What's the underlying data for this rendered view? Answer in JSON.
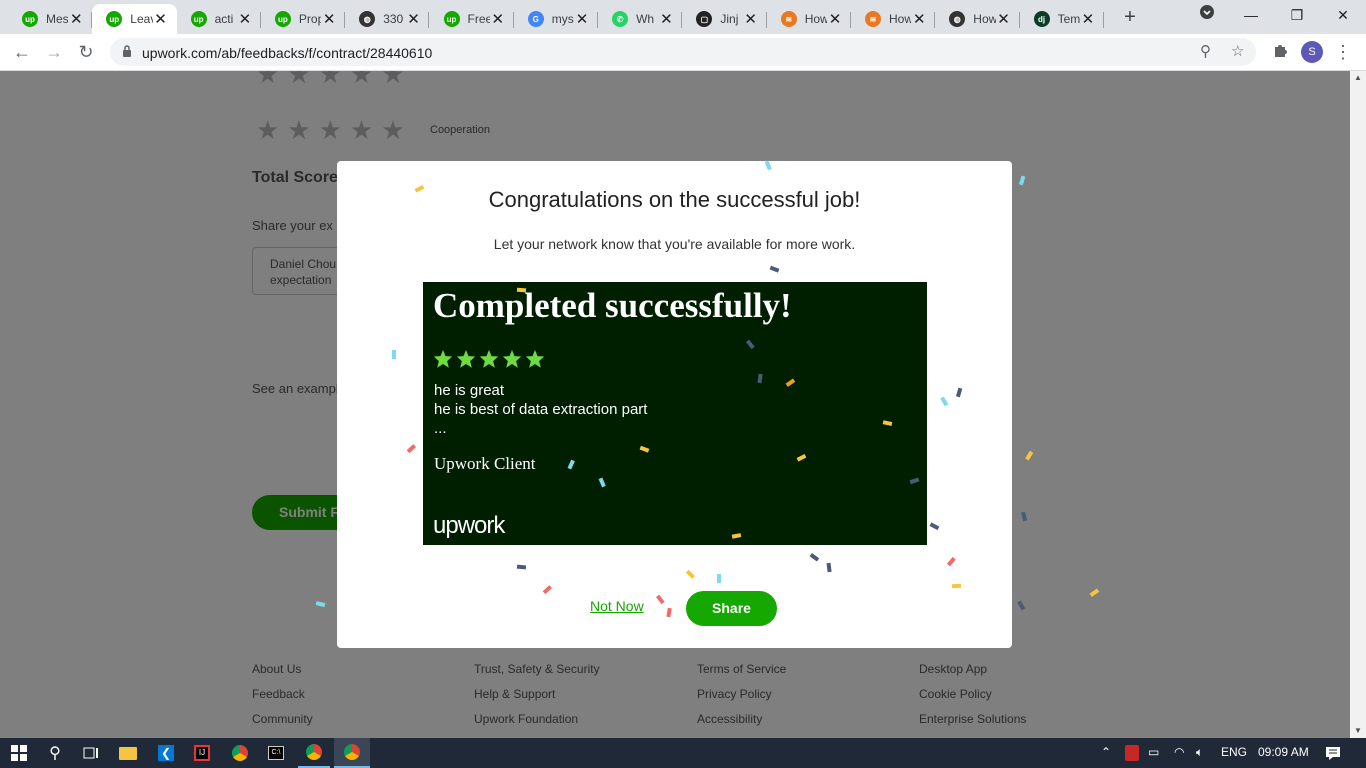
{
  "browser": {
    "tabs": [
      {
        "title": "Mes",
        "favicon": "upwork-icon",
        "color": "#14a800",
        "glyph": "up"
      },
      {
        "title": "Leav",
        "favicon": "upwork-icon",
        "color": "#14a800",
        "glyph": "up",
        "active": true
      },
      {
        "title": "acti",
        "favicon": "upwork-icon",
        "color": "#14a800",
        "glyph": "up"
      },
      {
        "title": "Prop",
        "favicon": "upwork-icon",
        "color": "#14a800",
        "glyph": "up"
      },
      {
        "title": "330",
        "favicon": "globe-icon",
        "color": "#333333",
        "glyph": "◍"
      },
      {
        "title": "Free",
        "favicon": "upwork-icon",
        "color": "#14a800",
        "glyph": "up"
      },
      {
        "title": "mys",
        "favicon": "google-icon",
        "color": "#4285f4",
        "glyph": "G"
      },
      {
        "title": "Wh",
        "favicon": "whatsapp-icon",
        "color": "#25d366",
        "glyph": "✆"
      },
      {
        "title": "Jinj",
        "favicon": "jinja-icon",
        "color": "#222222",
        "glyph": "▢"
      },
      {
        "title": "How",
        "favicon": "stackoverflow-icon",
        "color": "#e87922",
        "glyph": "≋"
      },
      {
        "title": "How",
        "favicon": "stackoverflow-icon",
        "color": "#e87922",
        "glyph": "≋"
      },
      {
        "title": "How",
        "favicon": "globe-icon",
        "color": "#333333",
        "glyph": "◍"
      },
      {
        "title": "Tem",
        "favicon": "django-icon",
        "color": "#0c3c26",
        "glyph": "dj"
      }
    ],
    "url": "upwork.com/ab/feedbacks/f/contract/28440610",
    "profile_initial": "S"
  },
  "background": {
    "criteria_label": "Cooperation",
    "total_score_label": "Total Score",
    "share_prompt": "Share your ex",
    "feedback_text_line1": "Daniel Chou",
    "feedback_text_line2": "expectation",
    "example_link": "See an example",
    "submit_label": "Submit F",
    "footer_col1": [
      "About Us",
      "Feedback",
      "Community"
    ],
    "footer_col2": [
      "Trust, Safety & Security",
      "Help & Support",
      "Upwork Foundation"
    ],
    "footer_col3": [
      "Terms of Service",
      "Privacy Policy",
      "Accessibility"
    ],
    "footer_col4": [
      "Desktop App",
      "Cookie Policy",
      "Enterprise Solutions"
    ]
  },
  "modal": {
    "title": "Congratulations on the successful job!",
    "subtitle": "Let your network know that you're available for more work.",
    "card": {
      "heading": "Completed successfully!",
      "rating": 5,
      "review_line1": "he is great",
      "review_line2": "he is best of data extraction part",
      "review_more": "...",
      "client": "Upwork Client",
      "logo": "upwork",
      "background_color": "#001e00",
      "star_color": "#6fda44"
    },
    "not_now": "Not Now",
    "share": "Share",
    "accent_color": "#14a800"
  },
  "taskbar": {
    "language": "ENG",
    "time": "09:09 AM"
  }
}
